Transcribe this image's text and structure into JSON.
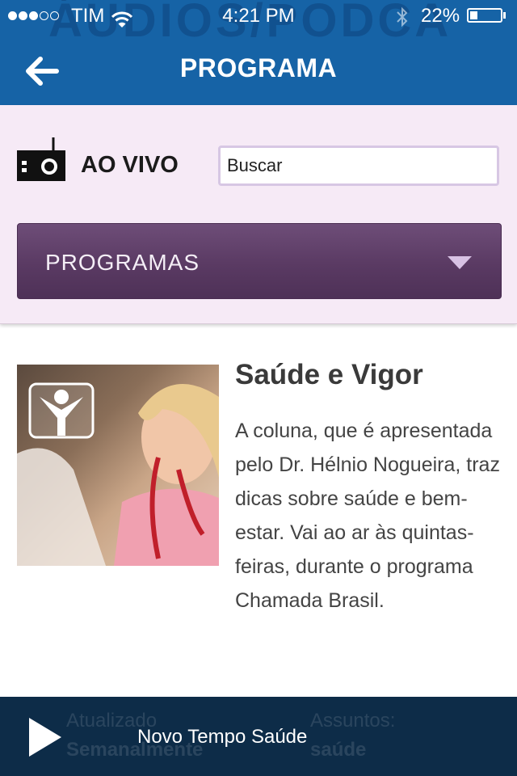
{
  "status_bar": {
    "carrier": "TIM",
    "time": "4:21 PM",
    "battery": "22%",
    "battery_level": 0.22
  },
  "header": {
    "watermark": "ÁUDIOS/PODCA",
    "title": "PROGRAMA",
    "back_icon": "arrow-left-icon"
  },
  "toolbar": {
    "live_label": "AO VIVO",
    "live_icon": "radio-icon",
    "search_value": "Buscar",
    "dropdown_label": "PROGRAMAS"
  },
  "program": {
    "title": "Saúde e Vigor",
    "description": "A coluna, que é apresentada pelo Dr. Hélnio Nogueira, traz dicas sobre saúde e bem-estar. Vai ao ar às quintas-feiras, durante o programa Chamada Brasil."
  },
  "hidden_meta": {
    "updated_label": "Atualizado",
    "updated_value": "Semanalmente",
    "subjects_label": "Assuntos:",
    "subjects_value": "saúde"
  },
  "player": {
    "now_playing": "Novo Tempo Saúde"
  },
  "colors": {
    "header": "#1663a6",
    "panel": "#f6eaf6",
    "dropdown": "#5a3a63",
    "player": "#0d2c48"
  }
}
